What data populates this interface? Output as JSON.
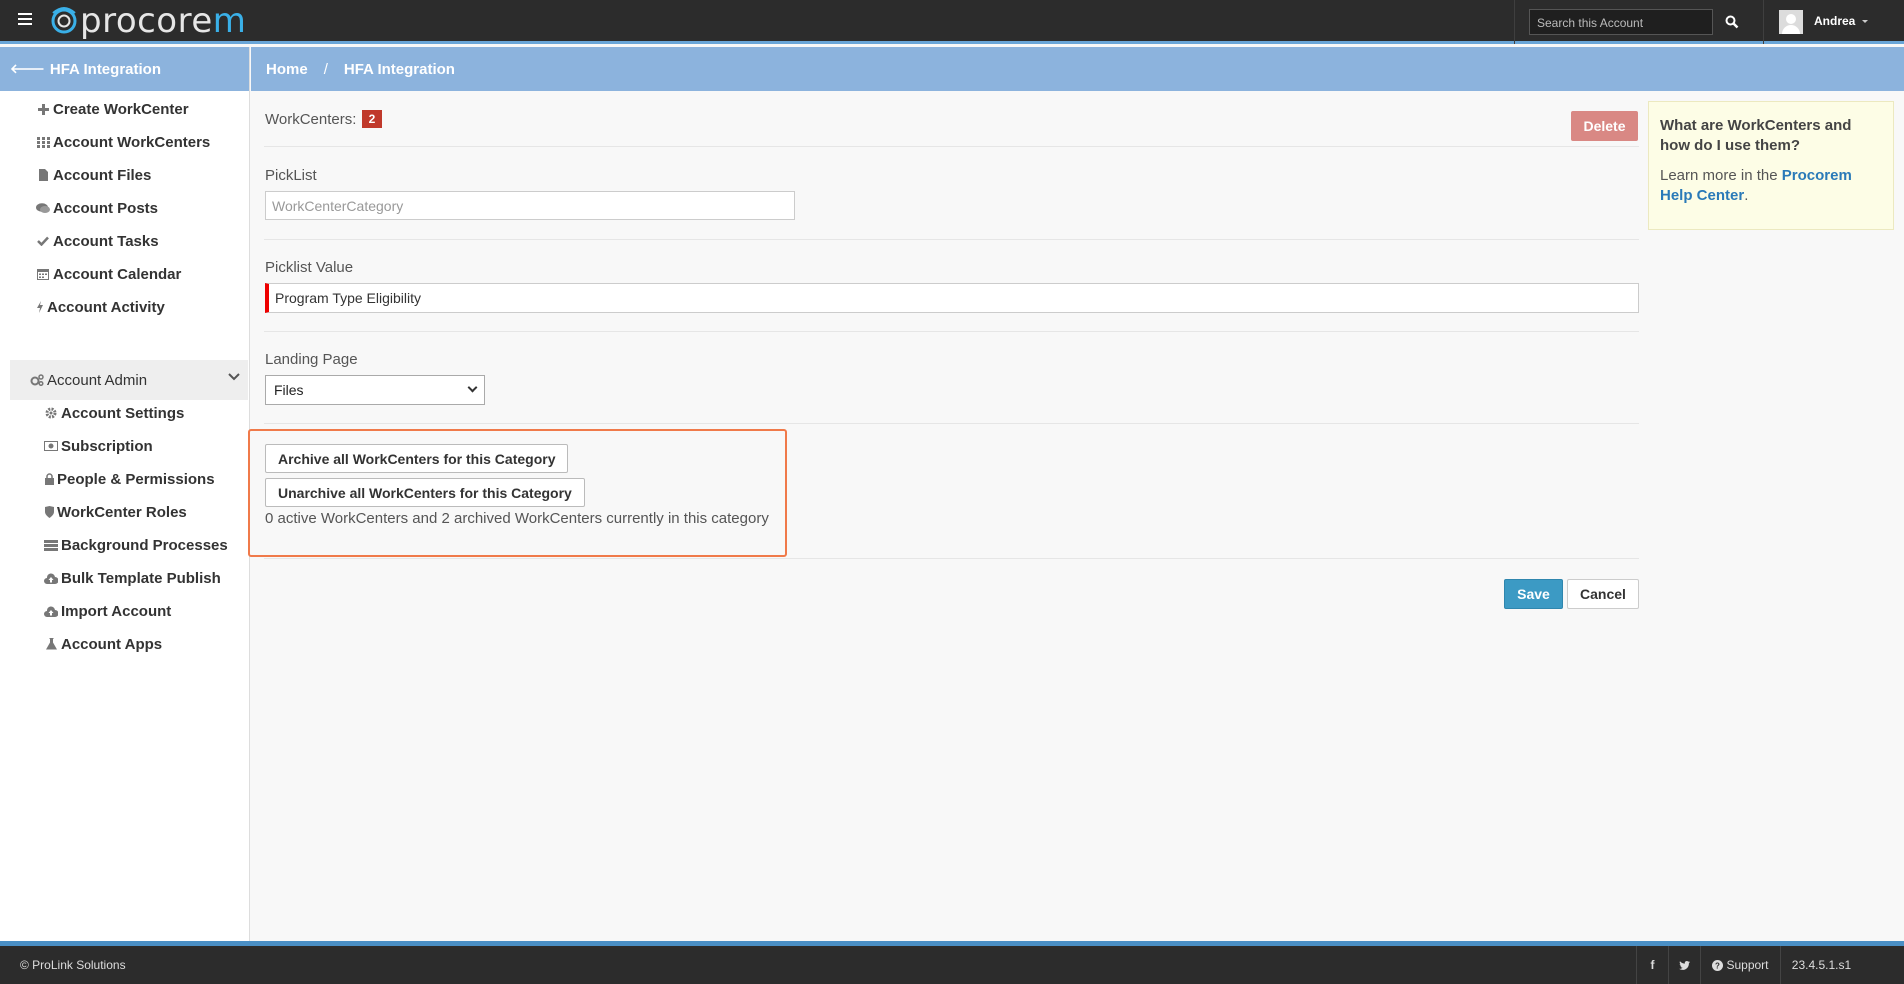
{
  "app": {
    "logo_text_main": "procore",
    "logo_text_accent": "m",
    "search_placeholder": "Search this Account",
    "username": "Andrea"
  },
  "sidebar": {
    "back_label": "HFA Integration",
    "items": [
      {
        "label": "Create WorkCenter",
        "icon": "plus-icon"
      },
      {
        "label": "Account WorkCenters",
        "icon": "grid-icon"
      },
      {
        "label": "Account Files",
        "icon": "file-icon"
      },
      {
        "label": "Account Posts",
        "icon": "comments-icon"
      },
      {
        "label": "Account Tasks",
        "icon": "check-icon"
      },
      {
        "label": "Account Calendar",
        "icon": "calendar-icon"
      },
      {
        "label": "Account Activity",
        "icon": "bolt-icon"
      }
    ],
    "admin_label": "Account Admin",
    "admin_items": [
      {
        "label": "Account Settings",
        "icon": "gear-icon"
      },
      {
        "label": "Subscription",
        "icon": "money-icon"
      },
      {
        "label": "People & Permissions",
        "icon": "lock-icon"
      },
      {
        "label": "WorkCenter Roles",
        "icon": "shield-icon"
      },
      {
        "label": "Background Processes",
        "icon": "tasks-icon"
      },
      {
        "label": "Bulk Template Publish",
        "icon": "cloud-upload-icon"
      },
      {
        "label": "Import Account",
        "icon": "cloud-upload-icon"
      },
      {
        "label": "Account Apps",
        "icon": "flask-icon"
      }
    ]
  },
  "breadcrumb": {
    "home": "Home",
    "separator": "/",
    "current": "HFA Integration"
  },
  "form": {
    "workcenters_label": "WorkCenters:",
    "workcenters_count": "2",
    "delete_label": "Delete",
    "picklist_label": "PickList",
    "picklist_value": "WorkCenterCategory",
    "picklist_value_label": "Picklist Value",
    "picklist_value_value": "Program Type Eligibility",
    "landing_page_label": "Landing Page",
    "landing_page_selected": "Files",
    "archive_label": "Archive all WorkCenters for this Category",
    "unarchive_label": "Unarchive all WorkCenters for this Category",
    "status_text": "0 active WorkCenters and 2 archived WorkCenters currently in this category",
    "save_label": "Save",
    "cancel_label": "Cancel"
  },
  "help": {
    "heading": "What are WorkCenters and how do I use them?",
    "text_prefix": "Learn more in the ",
    "link_text": "Procorem Help Center",
    "text_suffix": "."
  },
  "footer": {
    "copyright": "© ProLink Solutions",
    "facebook": "f",
    "support": "Support",
    "version": "23.4.5.1.s1"
  },
  "colors": {
    "topbar": "#2c2c2c",
    "accent_blue": "#8cb3dd",
    "brand_blue": "#3ab0e8",
    "delete": "#d98884",
    "save": "#3c9ac4",
    "badge": "#c0392b",
    "highlight": "#f07a4a"
  }
}
